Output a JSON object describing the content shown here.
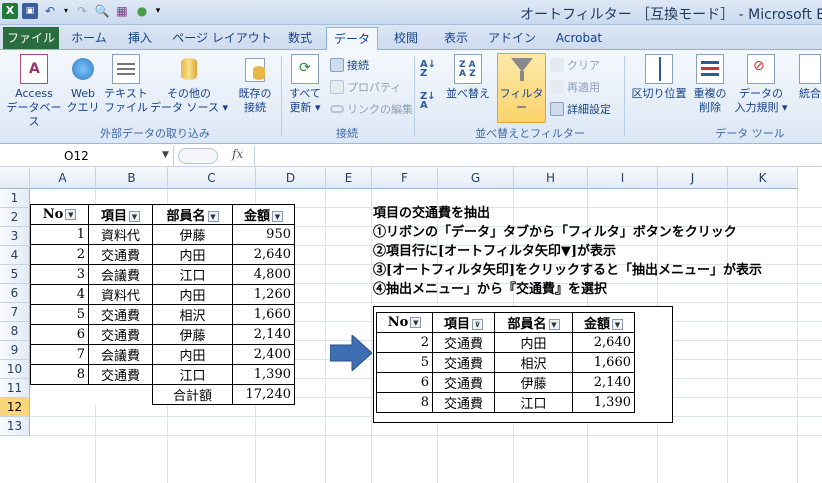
{
  "titlebar": {
    "title": "オートフィルター ［互換モード］ - Microsoft Exc",
    "excel_icon": "X",
    "qat_extra": "▾"
  },
  "tabs": [
    {
      "label": "ファイル"
    },
    {
      "label": "ホーム"
    },
    {
      "label": "挿入"
    },
    {
      "label": "ページ レイアウト"
    },
    {
      "label": "数式"
    },
    {
      "label": "データ"
    },
    {
      "label": "校閲"
    },
    {
      "label": "表示"
    },
    {
      "label": "アドイン"
    },
    {
      "label": "Acrobat"
    }
  ],
  "ribbon": {
    "access": [
      "Access",
      "データベース"
    ],
    "web": [
      "Web",
      "クエリ"
    ],
    "text": [
      "テキスト",
      "ファイル"
    ],
    "other": [
      "その他の",
      "データ ソース ▾"
    ],
    "existing": [
      "既存の",
      "接続"
    ],
    "refresh": [
      "すべて",
      "更新 ▾"
    ],
    "connections": "接続",
    "properties": "プロパティ",
    "edit_links": "リンクの編集",
    "sort": "並べ替え",
    "filter": "フィルター",
    "clear": "クリア",
    "reapply": "再適用",
    "advanced": "詳細設定",
    "text_to_columns": "区切り位置",
    "remove_dup": [
      "重複の",
      "削除"
    ],
    "validation": [
      "データの",
      "入力規則 ▾"
    ],
    "consolidate": "統合",
    "group_external": "外部データの取り込み",
    "group_connections": "接続",
    "group_sort": "並べ替えとフィルター",
    "group_tools": "データ ツール"
  },
  "formula_bar": {
    "name_box": "O12",
    "fx": "fx",
    "formula": ""
  },
  "columns": [
    "A",
    "B",
    "C",
    "D",
    "E",
    "F",
    "G",
    "H",
    "I",
    "J",
    "K"
  ],
  "rows": [
    "1",
    "2",
    "3",
    "4",
    "5",
    "6",
    "7",
    "8",
    "9",
    "10",
    "11",
    "12",
    "13"
  ],
  "main_table": {
    "headers": [
      "No",
      "項目",
      "部員名",
      "金額"
    ],
    "rows": [
      [
        "1",
        "資料代",
        "伊藤",
        "950"
      ],
      [
        "2",
        "交通費",
        "内田",
        "2,640"
      ],
      [
        "3",
        "会議費",
        "江口",
        "4,800"
      ],
      [
        "4",
        "資料代",
        "内田",
        "1,260"
      ],
      [
        "5",
        "交通費",
        "相沢",
        "1,660"
      ],
      [
        "6",
        "交通費",
        "伊藤",
        "2,140"
      ],
      [
        "7",
        "会議費",
        "内田",
        "2,400"
      ],
      [
        "8",
        "交通費",
        "江口",
        "1,390"
      ]
    ],
    "total_label": "合計額",
    "total_value": "17,240"
  },
  "notes": [
    "項目の交通費を抽出",
    "①リボンの「データ」タブから「フィルタ」ボタンをクリック",
    "②項目行に[オートフィルタ矢印▼]が表示",
    "③[オートフィルタ矢印]をクリックすると「抽出メニュー」が表示",
    "④抽出メニュー」から『交通費』を選択"
  ],
  "filtered_table": {
    "headers": [
      "No",
      "項目",
      "部員名",
      "金額"
    ],
    "rows": [
      [
        "2",
        "交通費",
        "内田",
        "2,640"
      ],
      [
        "5",
        "交通費",
        "相沢",
        "1,660"
      ],
      [
        "6",
        "交通費",
        "伊藤",
        "2,140"
      ],
      [
        "8",
        "交通費",
        "江口",
        "1,390"
      ]
    ]
  },
  "colors": {
    "file_tab": "#2a6d3c",
    "ribbon_text": "#15428b",
    "selected_row": "#f8d77a",
    "arrow": "#3f6fb3"
  }
}
